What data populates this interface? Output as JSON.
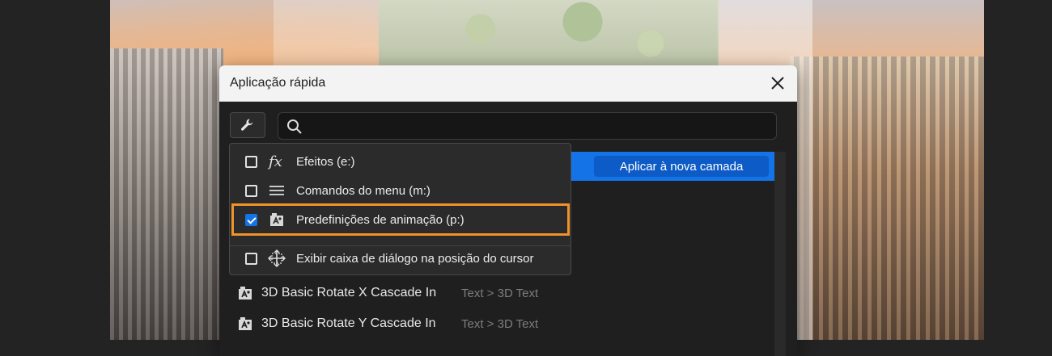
{
  "dialog": {
    "title": "Aplicação rápida",
    "search": {
      "value": "",
      "placeholder": ""
    }
  },
  "filter_menu": {
    "items": [
      {
        "label": "Efeitos (e:)",
        "checked": false,
        "icon": "fx-icon"
      },
      {
        "label": "Comandos do menu (m:)",
        "checked": false,
        "icon": "menu-lines-icon"
      },
      {
        "label": "Predefinições de animação (p:)",
        "checked": true,
        "icon": "animation-preset-icon"
      },
      {
        "label": "Exibir caixa de diálogo na posição do cursor",
        "checked": false,
        "icon": "cursor-position-icon"
      }
    ],
    "highlight_color": "#f0932a"
  },
  "results": {
    "apply_button": "Aplicar à nova camada",
    "rows": [
      {
        "name": "3D Basic Rotate X Cascade In",
        "path": "Text > 3D Text"
      },
      {
        "name": "3D Basic Rotate Y Cascade In",
        "path": "Text > 3D Text"
      }
    ]
  },
  "colors": {
    "accent": "#1473e6",
    "panel": "#1f1f1f",
    "titlebar": "#f3f3f3"
  }
}
